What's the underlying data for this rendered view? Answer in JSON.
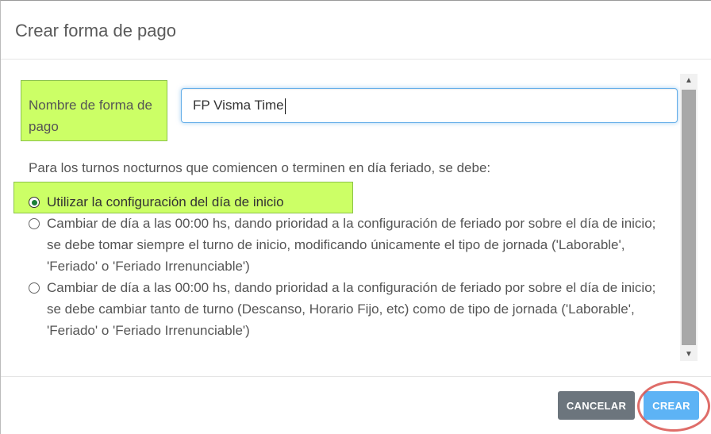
{
  "modal": {
    "title": "Crear forma de pago"
  },
  "form": {
    "name_label": "Nombre de forma de pago",
    "name_value": "FP Visma Time",
    "question": "Para los turnos nocturnos que comiencen o terminen en día feriado, se debe:",
    "options": [
      {
        "label": "Utilizar la configuración del día de inicio",
        "selected": true
      },
      {
        "label": "Cambiar de día a las 00:00 hs, dando prioridad a la configuración de feriado por sobre el día de inicio; se debe tomar siempre el turno de inicio, modificando únicamente el tipo de jornada ('Laborable', 'Feriado' o 'Feriado Irrenunciable')",
        "selected": false
      },
      {
        "label": "Cambiar de día a las 00:00 hs, dando prioridad a la configuración de feriado por sobre el día de inicio; se debe cambiar tanto de turno (Descanso, Horario Fijo, etc) como de tipo de jornada ('Laborable', 'Feriado' o 'Feriado Irrenunciable')",
        "selected": false
      }
    ]
  },
  "footer": {
    "cancel_label": "CANCELAR",
    "create_label": "CREAR"
  },
  "colors": {
    "highlight": "#ccff66",
    "cancel_button": "#6c757d",
    "create_button": "#5db3f5",
    "annotation": "#d9534f"
  },
  "icons": {
    "scroll_up": "triangle-up-icon",
    "scroll_down": "triangle-down-icon"
  }
}
